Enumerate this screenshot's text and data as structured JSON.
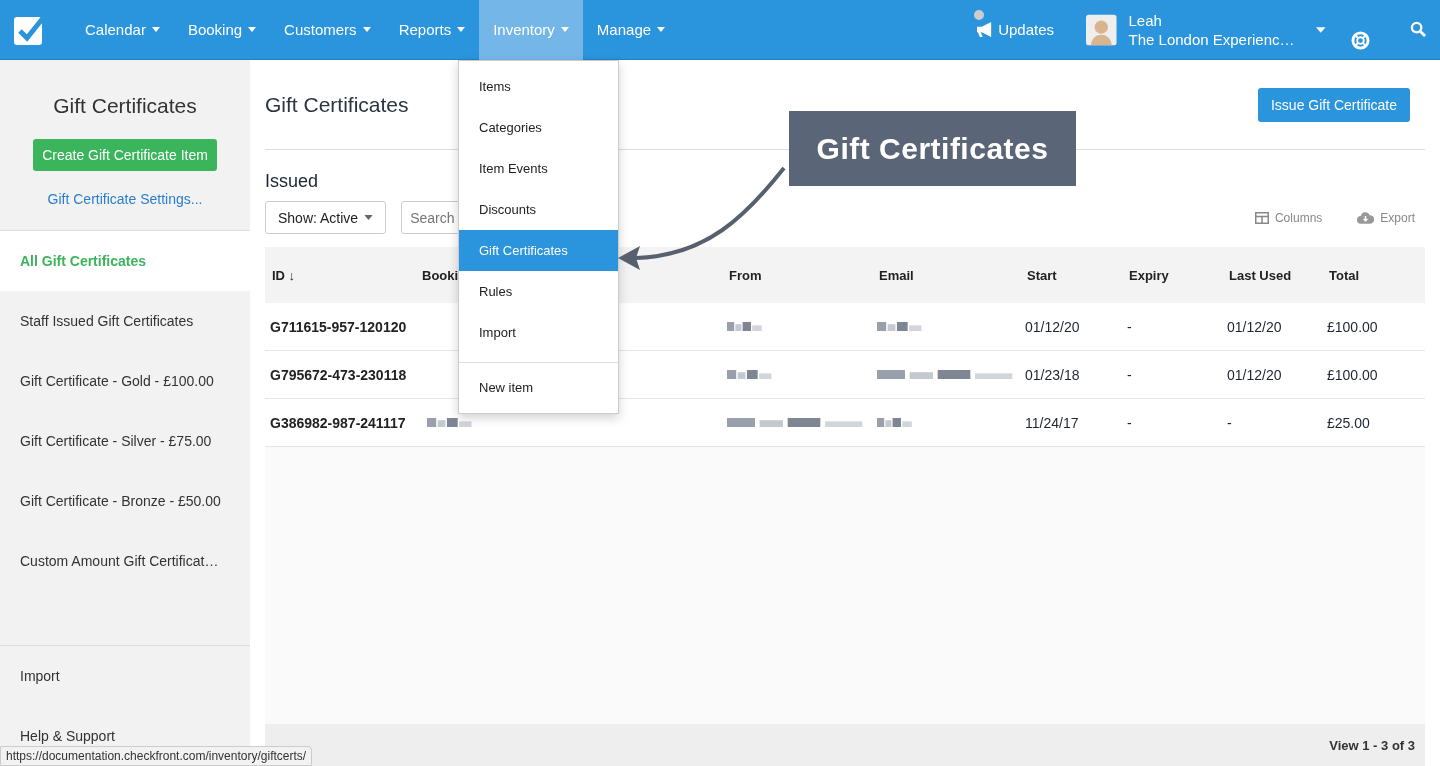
{
  "nav": {
    "items": [
      {
        "label": "Calendar",
        "selected": false
      },
      {
        "label": "Booking",
        "selected": false
      },
      {
        "label": "Customers",
        "selected": false
      },
      {
        "label": "Reports",
        "selected": false
      },
      {
        "label": "Inventory",
        "selected": true
      },
      {
        "label": "Manage",
        "selected": false
      }
    ],
    "updates": "Updates",
    "user": {
      "name": "Leah",
      "company": "The London Experienc…"
    }
  },
  "sidebar": {
    "title": "Gift Certificates",
    "create_button": "Create Gift Certificate Item",
    "settings_link": "Gift Certificate Settings...",
    "items": [
      {
        "label": "All Gift Certificates",
        "selected": true
      },
      {
        "label": "Staff Issued Gift Certificates",
        "selected": false
      },
      {
        "label": "Gift Certificate - Gold - £100.00",
        "selected": false
      },
      {
        "label": "Gift Certificate - Silver - £75.00",
        "selected": false
      },
      {
        "label": "Gift Certificate - Bronze - £50.00",
        "selected": false
      },
      {
        "label": "Custom Amount Gift Certificat…",
        "selected": false
      }
    ],
    "footer_items": [
      "Import",
      "Help & Support"
    ]
  },
  "page": {
    "title": "Gift Certificates",
    "issue_button": "Issue Gift Certificate",
    "section": "Issued",
    "show_filter": "Show: Active",
    "search": {
      "placeholder": "Search"
    },
    "columns_button": "Columns",
    "export_button": "Export"
  },
  "table": {
    "columns": [
      "ID ↓",
      "Booki",
      "From",
      "Email",
      "Start",
      "Expiry",
      "Last Used",
      "Total"
    ],
    "rows": [
      {
        "cells": [
          {
            "text": "G711615-957-120120"
          },
          {},
          {
            "redacted": true
          },
          {
            "redacted": true
          },
          {
            "text": "01/12/20"
          },
          {
            "text": "-"
          },
          {
            "text": "01/12/20"
          },
          {
            "text": "£100.00"
          }
        ]
      },
      {
        "cells": [
          {
            "text": "G795672-473-230118"
          },
          {},
          {
            "redacted": true
          },
          {
            "redacted": true
          },
          {
            "text": "01/23/18"
          },
          {
            "text": "-"
          },
          {
            "text": "01/12/20"
          },
          {
            "text": "£100.00"
          }
        ]
      },
      {
        "cells": [
          {
            "text": "G386982-987-241117"
          },
          {
            "redacted": true
          },
          {
            "redacted": true
          },
          {
            "redacted": true
          },
          {
            "text": "11/24/17"
          },
          {
            "text": "-"
          },
          {
            "text": "-"
          },
          {
            "text": "£25.00"
          }
        ]
      }
    ],
    "footer": "View 1 - 3 of 3"
  },
  "dropdown": {
    "items": [
      {
        "label": "Items",
        "selected": false
      },
      {
        "label": "Categories",
        "selected": false
      },
      {
        "label": "Item Events",
        "selected": false
      },
      {
        "label": "Discounts",
        "selected": false
      },
      {
        "label": "Gift Certificates",
        "selected": true
      },
      {
        "label": "Rules",
        "selected": false
      },
      {
        "label": "Import",
        "selected": false
      }
    ],
    "extra_item": "New item"
  },
  "callout": "Gift Certificates",
  "status_url": "https://documentation.checkfront.com/inventory/giftcerts/"
}
